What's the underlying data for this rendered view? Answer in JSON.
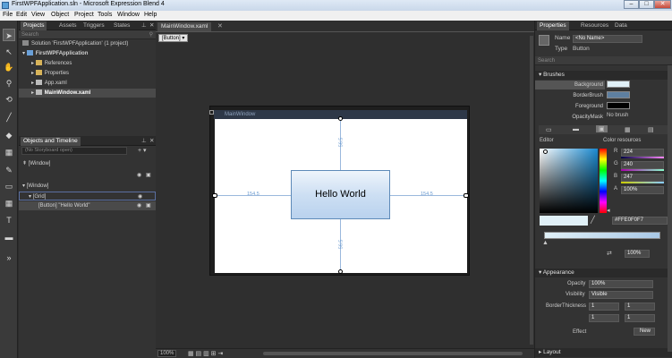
{
  "window": {
    "title": "FirstWPFApplication.sln - Microsoft Expression Blend 4",
    "min": "–",
    "max": "□",
    "close": "✕"
  },
  "menu": [
    "File",
    "Edit",
    "View",
    "Object",
    "Project",
    "Tools",
    "Window",
    "Help"
  ],
  "projects_panel": {
    "tabs": [
      "Projects",
      "Assets",
      "Triggers",
      "States"
    ],
    "search_placeholder": "Search",
    "tree": [
      "Solution 'FirstWPFApplication' (1 project)",
      "FirstWPFApplication",
      "References",
      "Properties",
      "App.xaml",
      "MainWindow.xaml"
    ]
  },
  "objects_panel": {
    "title": "Objects and Timeline",
    "storyboard": "(No Storyboard open)",
    "items": [
      "[Window]",
      "[Window]",
      "[Grid]",
      "[Button] \"Hello World\""
    ]
  },
  "document": {
    "tab": "MainWindow.xaml",
    "breadcrumb": "[Button] ▾",
    "window_title": "MainWindow",
    "button_text": "Hello World",
    "margin_left": "154.5",
    "margin_right": "154.5",
    "margin_top": "56.5",
    "margin_bottom": "56.5",
    "zoom": "100%"
  },
  "properties_panel": {
    "tabs": [
      "Properties",
      "Resources",
      "Data"
    ],
    "name_label": "Name",
    "name_value": "<No Name>",
    "type_label": "Type",
    "type_value": "Button",
    "search_placeholder": "Search",
    "brushes_title": "Brushes",
    "brush_rows": [
      {
        "label": "Background"
      },
      {
        "label": "BorderBrush"
      },
      {
        "label": "Foreground"
      },
      {
        "label": "OpacityMask",
        "value": "No brush"
      }
    ],
    "editor_label": "Editor",
    "color_resources_label": "Color resources",
    "rgb": [
      {
        "k": "R",
        "v": "224"
      },
      {
        "k": "G",
        "v": "240"
      },
      {
        "k": "B",
        "v": "247"
      },
      {
        "k": "A",
        "v": "100%"
      }
    ],
    "hex": "#FFE0F0F7",
    "gradient_stop_pct": "100%",
    "appearance_title": "Appearance",
    "opacity_label": "Opacity",
    "opacity_value": "100%",
    "visibility_label": "Visibility",
    "visibility_value": "Visible",
    "border_label": "BorderThickness",
    "border_values": [
      "1",
      "1",
      "1",
      "1"
    ],
    "effect_label": "Effect",
    "effect_button": "New",
    "layout_title": "Layout"
  },
  "colors": {
    "accent": "#6a9ad0",
    "button_top": "#eef4fb",
    "button_bottom": "#b9d2ee",
    "background_swatch": "#e0f0f7",
    "border_swatch": "#5e7fa0"
  }
}
